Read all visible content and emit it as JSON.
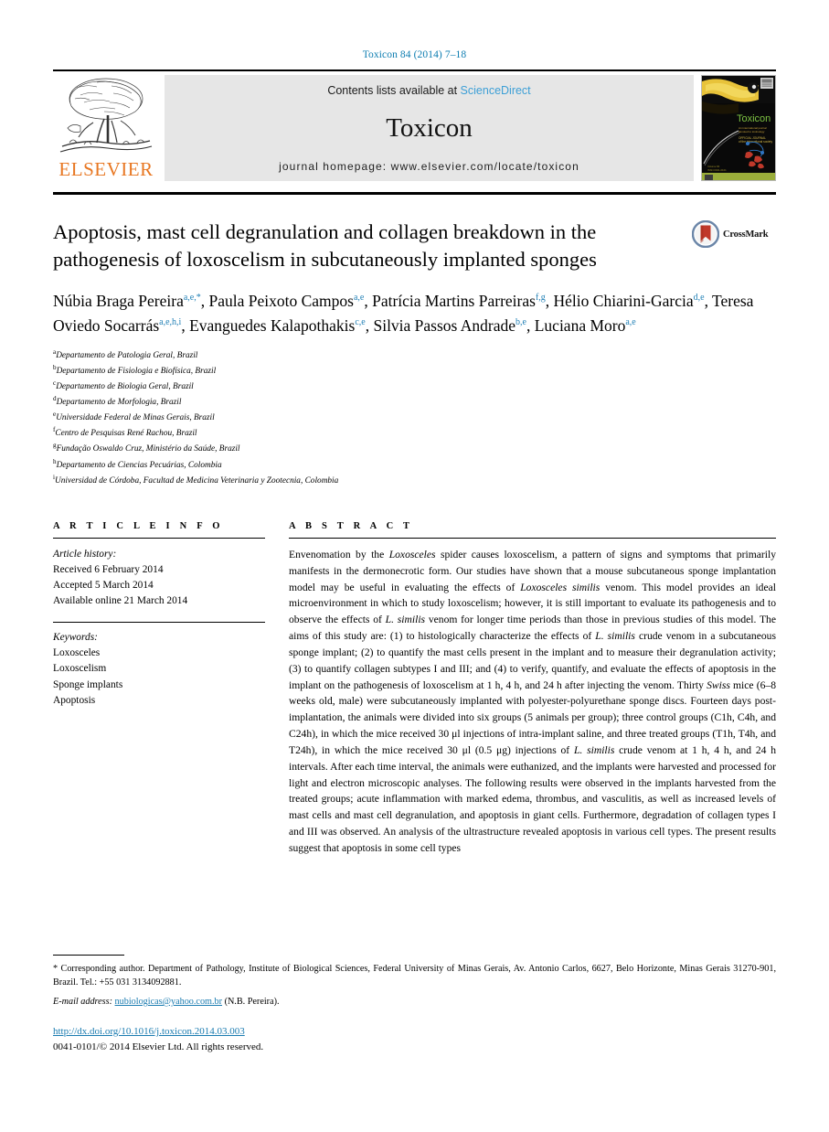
{
  "running_head": "Toxicon 84 (2014) 7–18",
  "masthead": {
    "publisher": "ELSEVIER",
    "contents_prefix": "Contents lists available at ",
    "contents_link": "ScienceDirect",
    "journal_name": "Toxicon",
    "homepage": "journal homepage: www.elsevier.com/locate/toxicon",
    "cover_title": "Toxicon"
  },
  "article": {
    "title": "Apoptosis, mast cell degranulation and collagen breakdown in the pathogenesis of loxoscelism in subcutaneously implanted sponges",
    "crossmark_label": "CrossMark",
    "authors": [
      {
        "name": "Núbia Braga Pereira",
        "sup": "a,e,*",
        "sep": ", "
      },
      {
        "name": "Paula Peixoto Campos",
        "sup": "a,e",
        "sep": ", "
      },
      {
        "name": "Patrícia Martins Parreiras",
        "sup": "f,g",
        "sep": ", "
      },
      {
        "name": "Hélio Chiarini-Garcia",
        "sup": "d,e",
        "sep": ", "
      },
      {
        "name": "Teresa Oviedo Socarrás",
        "sup": "a,e,h,i",
        "sep": ", "
      },
      {
        "name": "Evanguedes Kalapothakis",
        "sup": "c,e",
        "sep": ", "
      },
      {
        "name": "Silvia Passos Andrade",
        "sup": "b,e",
        "sep": ", "
      },
      {
        "name": "Luciana Moro",
        "sup": "a,e",
        "sep": ""
      }
    ],
    "affiliations": [
      {
        "mark": "a",
        "text": "Departamento de Patologia Geral, Brazil"
      },
      {
        "mark": "b",
        "text": "Departamento de Fisiologia e Biofísica, Brazil"
      },
      {
        "mark": "c",
        "text": "Departamento de Biologia Geral, Brazil"
      },
      {
        "mark": "d",
        "text": "Departamento de Morfologia, Brazil"
      },
      {
        "mark": "e",
        "text": "Universidade Federal de Minas Gerais, Brazil"
      },
      {
        "mark": "f",
        "text": "Centro de Pesquisas René Rachou, Brazil"
      },
      {
        "mark": "g",
        "text": "Fundação Oswaldo Cruz, Ministério da Saúde, Brazil"
      },
      {
        "mark": "h",
        "text": "Departamento de Ciencias Pecuárias, Colombia"
      },
      {
        "mark": "i",
        "text": "Universidad de Córdoba, Facultad de Medicina Veterinaria y Zootecnia, Colombia"
      }
    ]
  },
  "article_info": {
    "heading": "A R T I C L E   I N F O",
    "history_label": "Article history:",
    "history": [
      "Received 6 February 2014",
      "Accepted 5 March 2014",
      "Available online 21 March 2014"
    ],
    "keywords_label": "Keywords:",
    "keywords": [
      "Loxosceles",
      "Loxoscelism",
      "Sponge implants",
      "Apoptosis"
    ]
  },
  "abstract": {
    "heading": "A B S T R A C T",
    "paragraphs": [
      "Envenomation by the <i>Loxosceles</i> spider causes loxoscelism, a pattern of signs and symptoms that primarily manifests in the dermonecrotic form. Our studies have shown that a mouse subcutaneous sponge implantation model may be useful in evaluating the effects of <i>Loxosceles similis</i> venom. This model provides an ideal microenvironment in which to study loxoscelism; however, it is still important to evaluate its pathogenesis and to observe the effects of <i>L. similis</i> venom for longer time periods than those in previous studies of this model. The aims of this study are: (1) to histologically characterize the effects of <i>L. similis</i> crude venom in a subcutaneous sponge implant; (2) to quantify the mast cells present in the implant and to measure their degranulation activity; (3) to quantify collagen subtypes I and III; and (4) to verify, quantify, and evaluate the effects of apoptosis in the implant on the pathogenesis of loxoscelism at 1 h, 4 h, and 24 h after injecting the venom. Thirty <i>Swiss</i> mice (6–8 weeks old, male) were subcutaneously implanted with polyester-polyurethane sponge discs. Fourteen days post-implantation, the animals were divided into six groups (5 animals per group); three control groups (C1h, C4h, and C24h), in which the mice received 30 μl injections of intra-implant saline, and three treated groups (T1h, T4h, and T24h), in which the mice received 30 μl (0.5 μg) injections of <i>L. similis</i> crude venom at 1 h, 4 h, and 24 h intervals. After each time interval, the animals were euthanized, and the implants were harvested and processed for light and electron microscopic analyses. The following results were observed in the implants harvested from the treated groups; acute inflammation with marked edema, thrombus, and vasculitis, as well as increased levels of mast cells and mast cell degranulation, and apoptosis in giant cells. Furthermore, degradation of collagen types I and III was observed. An analysis of the ultrastructure revealed apoptosis in various cell types. The present results suggest that apoptosis in some cell types"
    ]
  },
  "footer": {
    "corresponding": "* Corresponding author. Department of Pathology, Institute of Biological Sciences, Federal University of Minas Gerais, Av. Antonio Carlos, 6627, Belo Horizonte, Minas Gerais 31270-901, Brazil. Tel.: +55 031 3134092881.",
    "email_label": "E-mail address:",
    "email": "nubiologicas@yahoo.com.br",
    "email_suffix": "(N.B. Pereira).",
    "doi": "http://dx.doi.org/10.1016/j.toxicon.2014.03.003",
    "copyright": "0041-0101/© 2014 Elsevier Ltd. All rights reserved."
  }
}
